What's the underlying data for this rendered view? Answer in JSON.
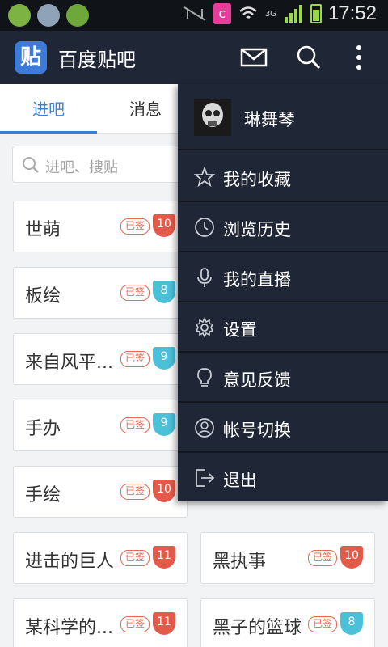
{
  "status_bar": {
    "time": "17:52",
    "network": "3G",
    "app_badge": "c"
  },
  "app": {
    "logo_text": "贴",
    "title": "百度贴吧"
  },
  "header_icons": [
    "mail-icon",
    "search-icon",
    "more-icon"
  ],
  "tabs": [
    {
      "label": "进吧",
      "active": true
    },
    {
      "label": "消息",
      "active": false
    }
  ],
  "search": {
    "placeholder": "进吧、搜贴"
  },
  "signed_label": "已签",
  "colors": {
    "header": "#1f2736",
    "accent": "#3b82d6",
    "level_red": "#e45a4a",
    "level_cyan": "#4bc0d9"
  },
  "forums": [
    {
      "name": "世萌",
      "level": "10",
      "level_color": "#e45a4a"
    },
    {
      "name": "板绘",
      "level": "8",
      "level_color": "#4bc0d9"
    },
    {
      "name": "来自风平...",
      "level": "9",
      "level_color": "#4bc0d9"
    },
    {
      "name": "手办",
      "level": "9",
      "level_color": "#4bc0d9"
    },
    {
      "name": "手绘",
      "level": "10",
      "level_color": "#e45a4a"
    },
    {
      "name": "进击的巨人",
      "level": "11",
      "level_color": "#e45a4a"
    },
    {
      "name": "黑执事",
      "level": "10",
      "level_color": "#e45a4a"
    },
    {
      "name": "某科学的...",
      "level": "11",
      "level_color": "#e45a4a"
    },
    {
      "name": "黑子的篮球",
      "level": "8",
      "level_color": "#4bc0d9"
    }
  ],
  "menu": {
    "user": {
      "name": "琳舞琴"
    },
    "items": [
      {
        "label": "我的收藏",
        "icon": "star-icon"
      },
      {
        "label": "浏览历史",
        "icon": "clock-icon"
      },
      {
        "label": "我的直播",
        "icon": "microphone-icon"
      },
      {
        "label": "设置",
        "icon": "gear-icon"
      },
      {
        "label": "意见反馈",
        "icon": "lightbulb-icon"
      },
      {
        "label": "帐号切换",
        "icon": "account-icon"
      },
      {
        "label": "退出",
        "icon": "logout-icon"
      }
    ]
  }
}
